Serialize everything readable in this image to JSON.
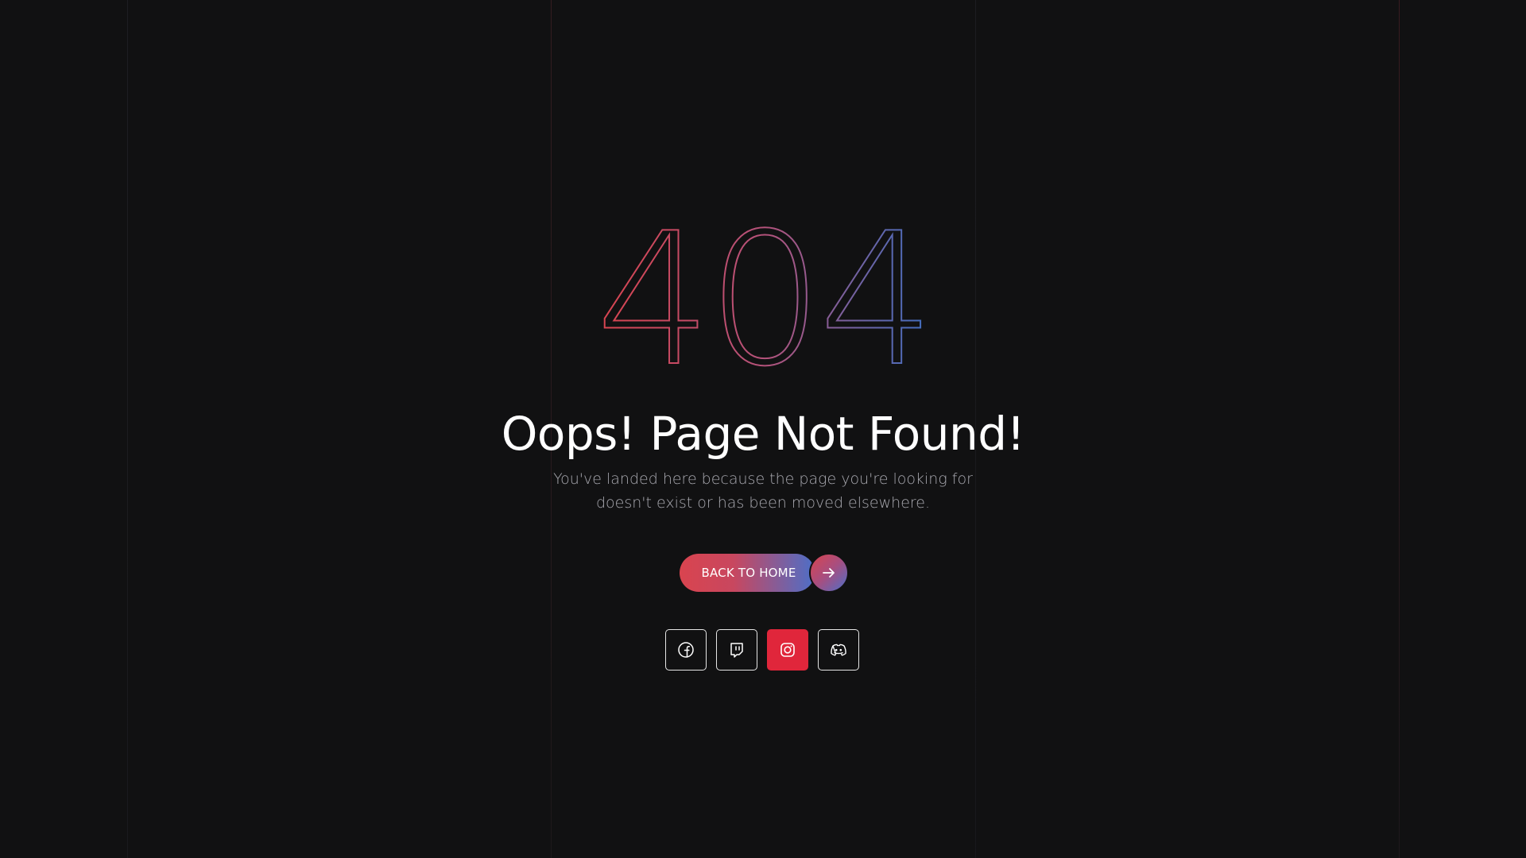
{
  "error": {
    "code": "404",
    "gradient_start": "#d9444f",
    "gradient_mid": "#b5527a",
    "gradient_end": "#3f6fc2"
  },
  "title": "Oops! Page Not Found!",
  "subtitle": "You've landed here because the page you're looking for doesn't exist or has been moved elsewhere.",
  "cta": {
    "label": "BACK TO HOME",
    "icon": "arrow-right-icon"
  },
  "socials": [
    {
      "name": "facebook",
      "icon": "facebook-icon",
      "active": false
    },
    {
      "name": "twitch",
      "icon": "twitch-icon",
      "active": false
    },
    {
      "name": "instagram",
      "icon": "instagram-icon",
      "active": true
    },
    {
      "name": "discord",
      "icon": "discord-icon",
      "active": false
    }
  ],
  "colors": {
    "background": "#111112",
    "accent_red": "#e0263b",
    "accent_blue": "#4d6fc8",
    "text": "#ffffff",
    "muted_text": "#a9a9b0"
  }
}
